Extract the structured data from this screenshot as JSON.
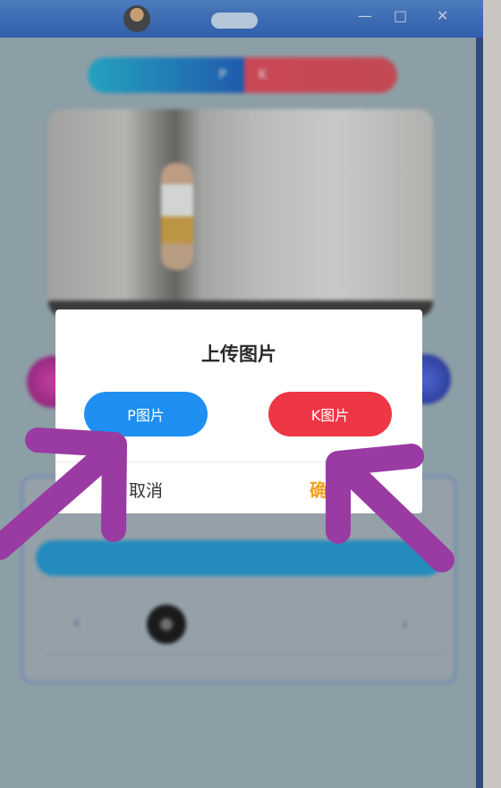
{
  "titlebar": {
    "app_label": "",
    "controls": [
      "—",
      "□",
      "✕"
    ]
  },
  "background": {
    "segment": {
      "left": "P",
      "right": "K"
    },
    "tabs": [
      "",
      "",
      ""
    ],
    "row": {
      "left_symbol": "‹",
      "name": "",
      "right_symbol": "›"
    }
  },
  "dialog": {
    "title": "上传图片",
    "p_button": "P图片",
    "k_button": "K图片",
    "cancel": "取消",
    "confirm": "确"
  },
  "colors": {
    "p_button": "#1f8ff1",
    "k_button": "#ee3644",
    "confirm": "#f0a020",
    "arrow": "#9a3aa3"
  }
}
